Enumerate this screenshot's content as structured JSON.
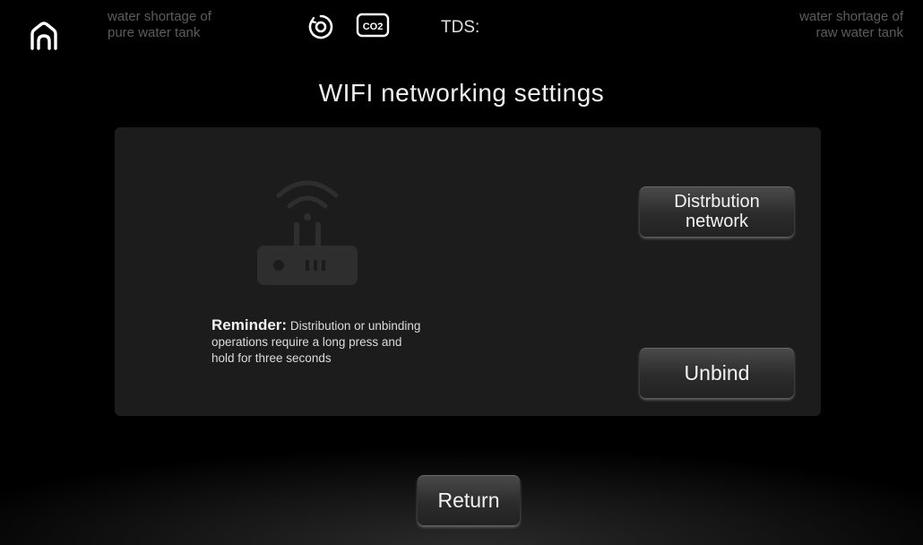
{
  "header": {
    "left_status": [
      "water shortage of",
      "pure water tank"
    ],
    "right_status": [
      "water shortage of",
      "raw water tank"
    ],
    "tds_label": "TDS:",
    "co2_icon_text": "CO2",
    "icons": [
      "home-icon",
      "filter-icon",
      "co2-icon"
    ]
  },
  "title": "WIFI networking settings",
  "panel": {
    "reminder_head": "Reminder:",
    "reminder_body": "Distribution or unbinding operations require a long press and hold for three seconds",
    "icon": "router-icon",
    "distribution_label": [
      "Distrbution",
      "network"
    ],
    "unbind_label": "Unbind"
  },
  "footer": {
    "return_label": "Return"
  },
  "colors": {
    "background": "#000000",
    "panel": "#1c1c1c",
    "dim_text": "#5c5c5c",
    "text": "#f0f0f0"
  }
}
